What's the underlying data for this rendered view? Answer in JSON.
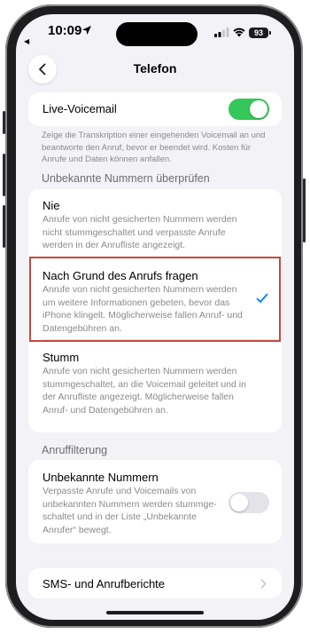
{
  "status": {
    "time": "10:09",
    "battery": "93"
  },
  "nav": {
    "title": "Telefon"
  },
  "live_voicemail": {
    "label": "Live-Voicemail",
    "enabled": true,
    "footnote": "Zeige die Transkription einer eingehenden Voicemail an und beantworte den Anruf, bevor er beendet wird. Kosten für Anrufe und Daten können anfallen."
  },
  "unknown_section": {
    "header": "Unbekannte Nummern überprüfen",
    "options": [
      {
        "title": "Nie",
        "description": "Anrufe von nicht gesicherten Nummern werden nicht stummgeschaltet und verpasste Anrufe werden in der Anrufliste angezeigt.",
        "selected": false
      },
      {
        "title": "Nach Grund des Anrufs fragen",
        "description": "Anrufe von nicht gesicherten Nummern werden um weitere Informationen gebeten, bevor das iPhone klingelt. Möglicherweise fallen Anruf- und Datengebühren an.",
        "selected": true
      },
      {
        "title": "Stumm",
        "description": "Anrufe von nicht gesicherten Nummern werden stummgeschaltet, an die Voicemail geleitet und in der Anrufliste angezeigt. Möglicherweise fallen Anruf- und Datengebühren an.",
        "selected": false
      }
    ]
  },
  "filter_section": {
    "header": "Anruffilterung",
    "item": {
      "title": "Unbekannte Nummern",
      "description": "Verpasste Anrufe und Voicemails von unbekannten Nummern werden stummge-schaltet und in der Liste „Unbekannte Anrufer“ bewegt.",
      "enabled": false
    }
  },
  "sms_report": {
    "label": "SMS- und Anrufberichte"
  },
  "colors": {
    "accent": "#007aff",
    "toggle_on": "#34c759",
    "toggle_off": "#e3e3e8",
    "highlight": "#c5483c"
  },
  "icons": {
    "back": "chevron-left-icon",
    "check": "checkmark-icon",
    "chevron": "chevron-right-icon"
  }
}
